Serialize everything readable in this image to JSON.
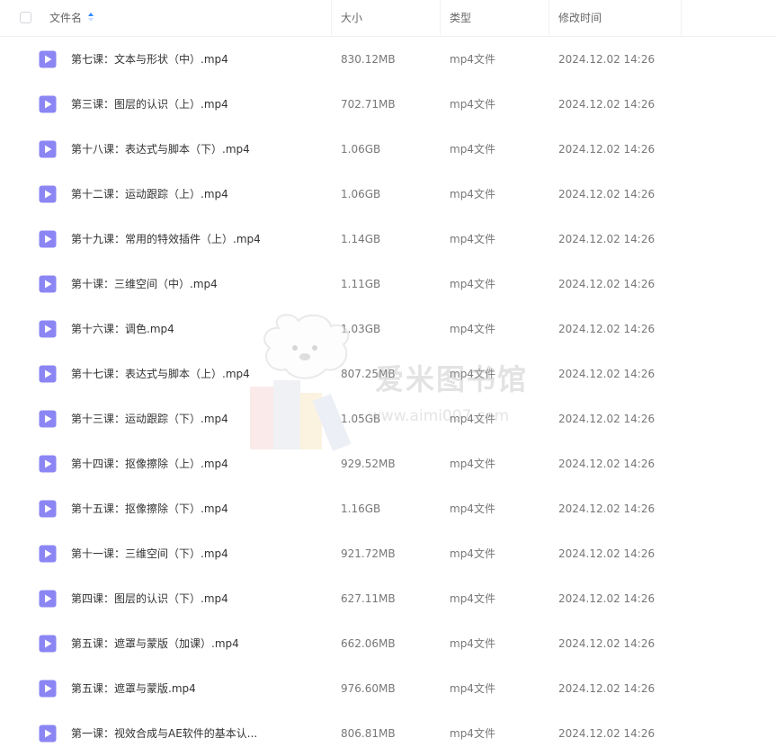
{
  "header": {
    "name_label": "文件名",
    "size_label": "大小",
    "type_label": "类型",
    "modified_label": "修改时间"
  },
  "files": [
    {
      "name": "第七课：文本与形状（中）.mp4",
      "size": "830.12MB",
      "type": "mp4文件",
      "modified": "2024.12.02 14:26"
    },
    {
      "name": "第三课：图层的认识（上）.mp4",
      "size": "702.71MB",
      "type": "mp4文件",
      "modified": "2024.12.02 14:26"
    },
    {
      "name": "第十八课：表达式与脚本（下）.mp4",
      "size": "1.06GB",
      "type": "mp4文件",
      "modified": "2024.12.02 14:26"
    },
    {
      "name": "第十二课：运动跟踪（上）.mp4",
      "size": "1.06GB",
      "type": "mp4文件",
      "modified": "2024.12.02 14:26"
    },
    {
      "name": "第十九课：常用的特效插件（上）.mp4",
      "size": "1.14GB",
      "type": "mp4文件",
      "modified": "2024.12.02 14:26"
    },
    {
      "name": "第十课：三维空间（中）.mp4",
      "size": "1.11GB",
      "type": "mp4文件",
      "modified": "2024.12.02 14:26"
    },
    {
      "name": "第十六课：调色.mp4",
      "size": "1.03GB",
      "type": "mp4文件",
      "modified": "2024.12.02 14:26"
    },
    {
      "name": "第十七课：表达式与脚本（上）.mp4",
      "size": "807.25MB",
      "type": "mp4文件",
      "modified": "2024.12.02 14:26"
    },
    {
      "name": "第十三课：运动跟踪（下）.mp4",
      "size": "1.05GB",
      "type": "mp4文件",
      "modified": "2024.12.02 14:26"
    },
    {
      "name": "第十四课：抠像擦除（上）.mp4",
      "size": "929.52MB",
      "type": "mp4文件",
      "modified": "2024.12.02 14:26"
    },
    {
      "name": "第十五课：抠像擦除（下）.mp4",
      "size": "1.16GB",
      "type": "mp4文件",
      "modified": "2024.12.02 14:26"
    },
    {
      "name": "第十一课：三维空间（下）.mp4",
      "size": "921.72MB",
      "type": "mp4文件",
      "modified": "2024.12.02 14:26"
    },
    {
      "name": "第四课：图层的认识（下）.mp4",
      "size": "627.11MB",
      "type": "mp4文件",
      "modified": "2024.12.02 14:26"
    },
    {
      "name": "第五课：遮罩与蒙版（加课）.mp4",
      "size": "662.06MB",
      "type": "mp4文件",
      "modified": "2024.12.02 14:26"
    },
    {
      "name": "第五课：遮罩与蒙版.mp4",
      "size": "976.60MB",
      "type": "mp4文件",
      "modified": "2024.12.02 14:26"
    },
    {
      "name": "第一课：视效合成与AE软件的基本认...",
      "size": "806.81MB",
      "type": "mp4文件",
      "modified": "2024.12.02 14:26"
    }
  ],
  "icons": {
    "file_icon": "video-file-icon",
    "file_icon_color": "#8b86f3",
    "sort_color": "#2f88ff"
  },
  "watermark": {
    "title": "爱米图书馆",
    "url": "www.aimi007.com"
  }
}
